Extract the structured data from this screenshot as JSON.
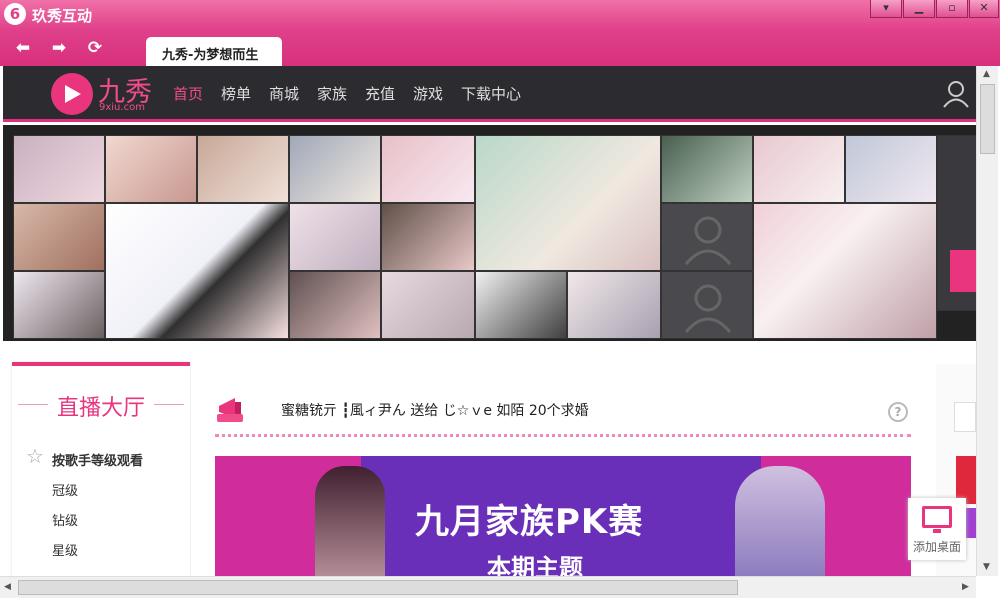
{
  "window": {
    "title": "玖秀互动",
    "logo_glyph": "6"
  },
  "tab": {
    "label": "九秀-为梦想而生"
  },
  "nav_buttons": {
    "back": "back-icon",
    "forward": "forward-icon",
    "refresh": "refresh-icon"
  },
  "site": {
    "logo_text": "九秀",
    "logo_sub": "9xiu.com",
    "menu": [
      "首页",
      "榜单",
      "商城",
      "家族",
      "充值",
      "游戏",
      "下载中心"
    ],
    "active_menu": "首页"
  },
  "sidebar": {
    "title": "直播大厅",
    "sort_label": "按歌手等级观看",
    "levels": [
      "冠级",
      "钻级",
      "星级"
    ]
  },
  "marquee": {
    "text": "蜜糖铳亓 ┇風ィ尹ん 送给  じ☆ｖe 如陌 20个求婚"
  },
  "promo": {
    "title": "九月家族PK赛",
    "subtitle": "本期主题"
  },
  "add_desktop": {
    "label": "添加桌面"
  },
  "colors": {
    "brand": "#e8357e",
    "titlebar": "#e0408a",
    "header_bg": "#2c2c30"
  }
}
